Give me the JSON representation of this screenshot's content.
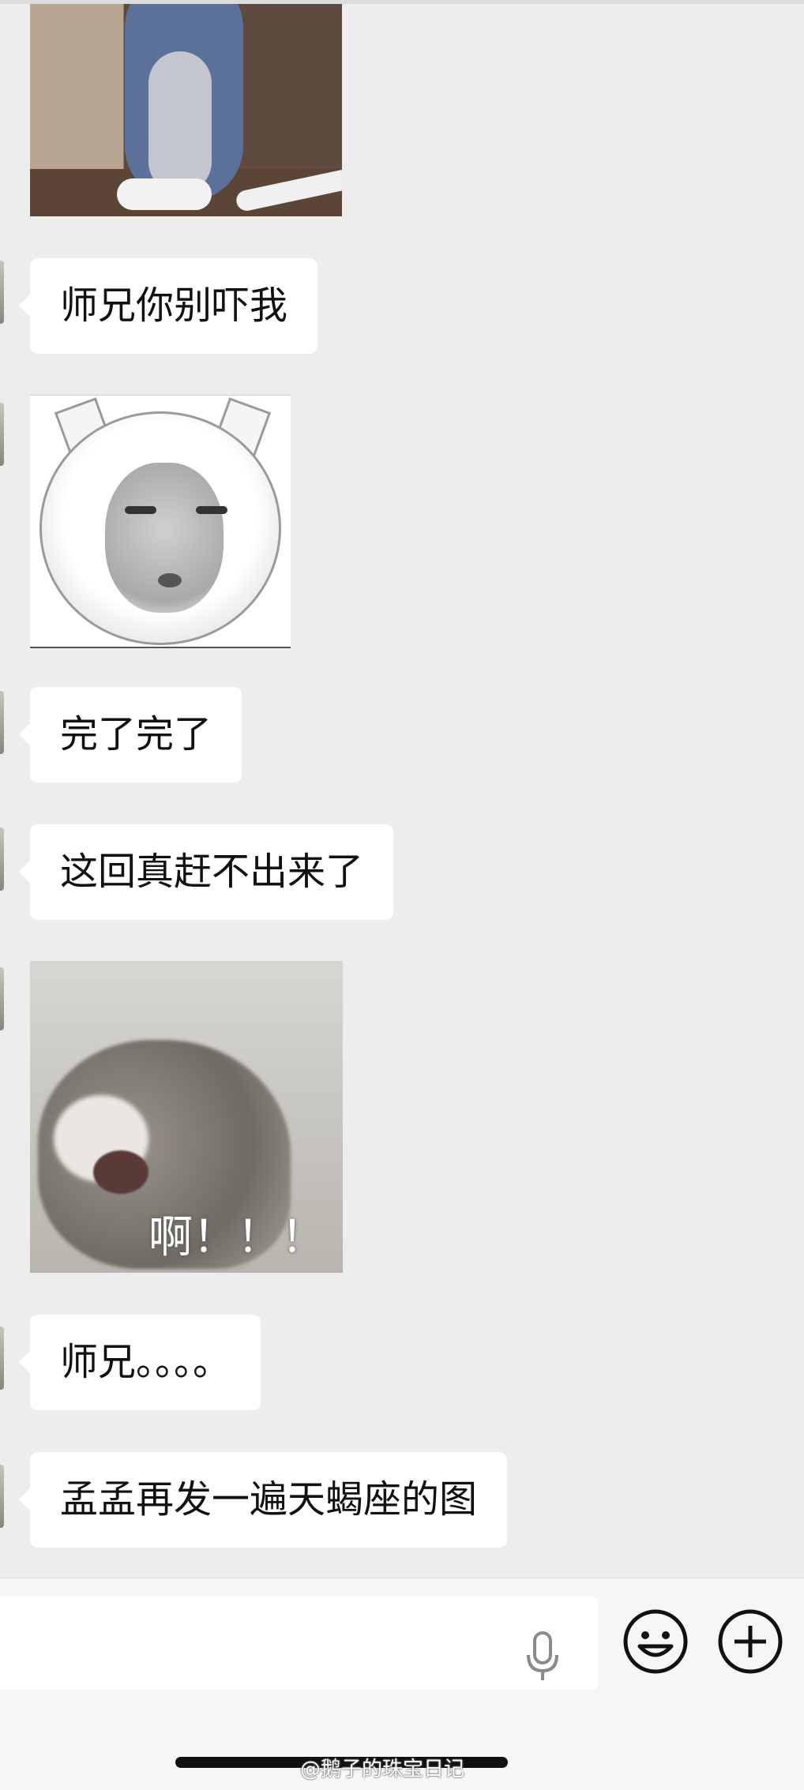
{
  "messages": [
    {
      "type": "sticker",
      "description": "tom-cat"
    },
    {
      "type": "text",
      "text": "师兄你别吓我"
    },
    {
      "type": "sticker",
      "description": "round-face"
    },
    {
      "type": "text",
      "text": "完了完了"
    },
    {
      "type": "text",
      "text": "这回真赶不出来了"
    },
    {
      "type": "sticker",
      "caption": "啊！！！"
    },
    {
      "type": "text",
      "text": "师兄。。。。"
    },
    {
      "type": "text",
      "text": "孟孟再发一遍天蝎座的图"
    }
  ],
  "input": {
    "placeholder": "",
    "icons": [
      "microphone-icon",
      "emoji-icon",
      "plus-icon"
    ]
  },
  "watermark": "@鹅子的珠宝日记",
  "colors": {
    "background": "#ededed",
    "bubble": "#ffffff",
    "input_bar": "#f6f6f6"
  }
}
